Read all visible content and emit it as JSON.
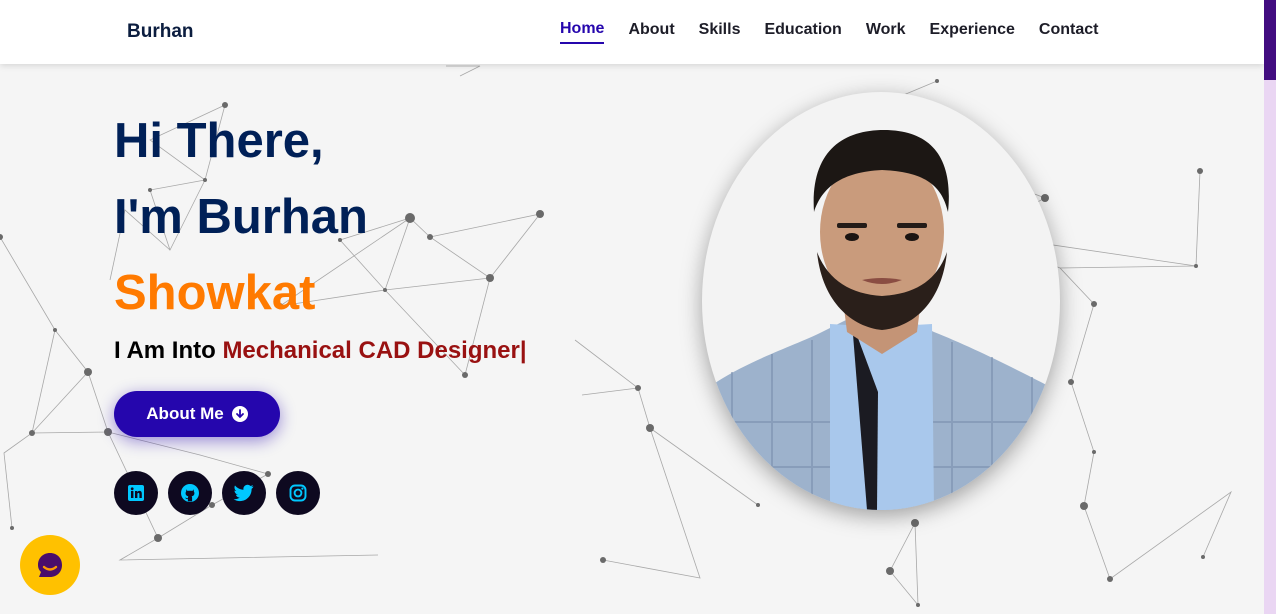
{
  "brand": {
    "name": "Burhan"
  },
  "nav": {
    "items": [
      {
        "label": "Home",
        "active": true
      },
      {
        "label": "About"
      },
      {
        "label": "Skills"
      },
      {
        "label": "Education"
      },
      {
        "label": "Work"
      },
      {
        "label": "Experience"
      },
      {
        "label": "Contact"
      }
    ]
  },
  "hero": {
    "greeting": "Hi There,",
    "intro": "I'm Burhan",
    "surname": "Showkat",
    "typed_prefix": "I Am Into",
    "typed_role": "Mechanical CAD Designer",
    "cursor": "|",
    "about_button": "About Me"
  },
  "socials": [
    {
      "icon": "linkedin-icon"
    },
    {
      "icon": "github-icon"
    },
    {
      "icon": "twitter-icon"
    },
    {
      "icon": "instagram-icon"
    }
  ],
  "colors": {
    "navy": "#002057",
    "accent_orange": "#ff7a00",
    "primary_purple": "#2506ad",
    "role_red": "#991111",
    "social_icon": "#00c8ff",
    "chat_yellow": "#ffc100"
  }
}
